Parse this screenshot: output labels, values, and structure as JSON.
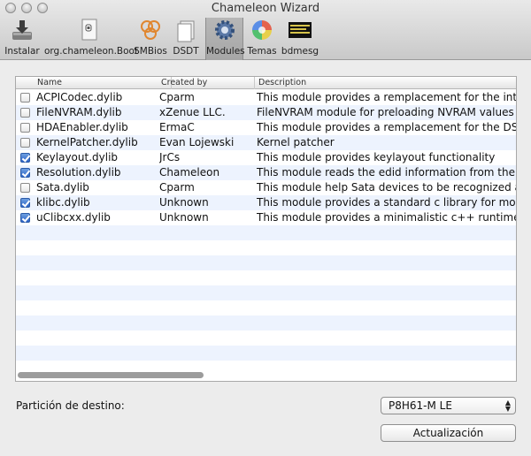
{
  "window": {
    "title": "Chameleon Wizard"
  },
  "toolbar": {
    "items": [
      {
        "label": "Instalar",
        "icon": "install-drive-icon"
      },
      {
        "label": "org.chameleon.Boot",
        "icon": "boot-plist-icon"
      },
      {
        "label": "SMBios",
        "icon": "smbios-rings-icon"
      },
      {
        "label": "DSDT",
        "icon": "dsdt-document-icon"
      },
      {
        "label": "Modules",
        "icon": "modules-gear-icon"
      },
      {
        "label": "Temas",
        "icon": "themes-color-wheel-icon"
      },
      {
        "label": "bdmesg",
        "icon": "bdmesg-console-icon"
      }
    ],
    "selected": "Modules"
  },
  "table": {
    "columns": [
      "Name",
      "Created by",
      "Description"
    ],
    "rows": [
      {
        "checked": false,
        "name": "ACPICodec.dylib",
        "created_by": "Cparm",
        "description": "This module provides a remplacement for the interna"
      },
      {
        "checked": false,
        "name": "FileNVRAM.dylib",
        "created_by": "xZenue LLC.",
        "description": "FileNVRAM module for preloading NVRAM values"
      },
      {
        "checked": false,
        "name": "HDAEnabler.dylib",
        "created_by": "ErmaC",
        "description": "This module provides a remplacement for the DSDT e"
      },
      {
        "checked": false,
        "name": "KernelPatcher.dylib",
        "created_by": "Evan Lojewski",
        "description": "Kernel patcher"
      },
      {
        "checked": true,
        "name": "Keylayout.dylib",
        "created_by": "JrCs",
        "description": "This module provides keylayout functionality"
      },
      {
        "checked": true,
        "name": "Resolution.dylib",
        "created_by": "Chameleon",
        "description": "This module reads the edid information from the mo"
      },
      {
        "checked": false,
        "name": "Sata.dylib",
        "created_by": "Cparm",
        "description": "This module help Sata devices to be recognized as in"
      },
      {
        "checked": true,
        "name": "klibc.dylib",
        "created_by": "Unknown",
        "description": "This module provides a standard c library for module"
      },
      {
        "checked": true,
        "name": "uClibcxx.dylib",
        "created_by": "Unknown",
        "description": "This module provides a minimalistic c++ runtime lib"
      }
    ]
  },
  "destination": {
    "label": "Partición de destino:",
    "selected": "P8H61-M LE"
  },
  "actions": {
    "update_label": "Actualización"
  },
  "colors": {
    "checkbox_on": "#2c63c7",
    "row_alt": "#edf3fe"
  }
}
